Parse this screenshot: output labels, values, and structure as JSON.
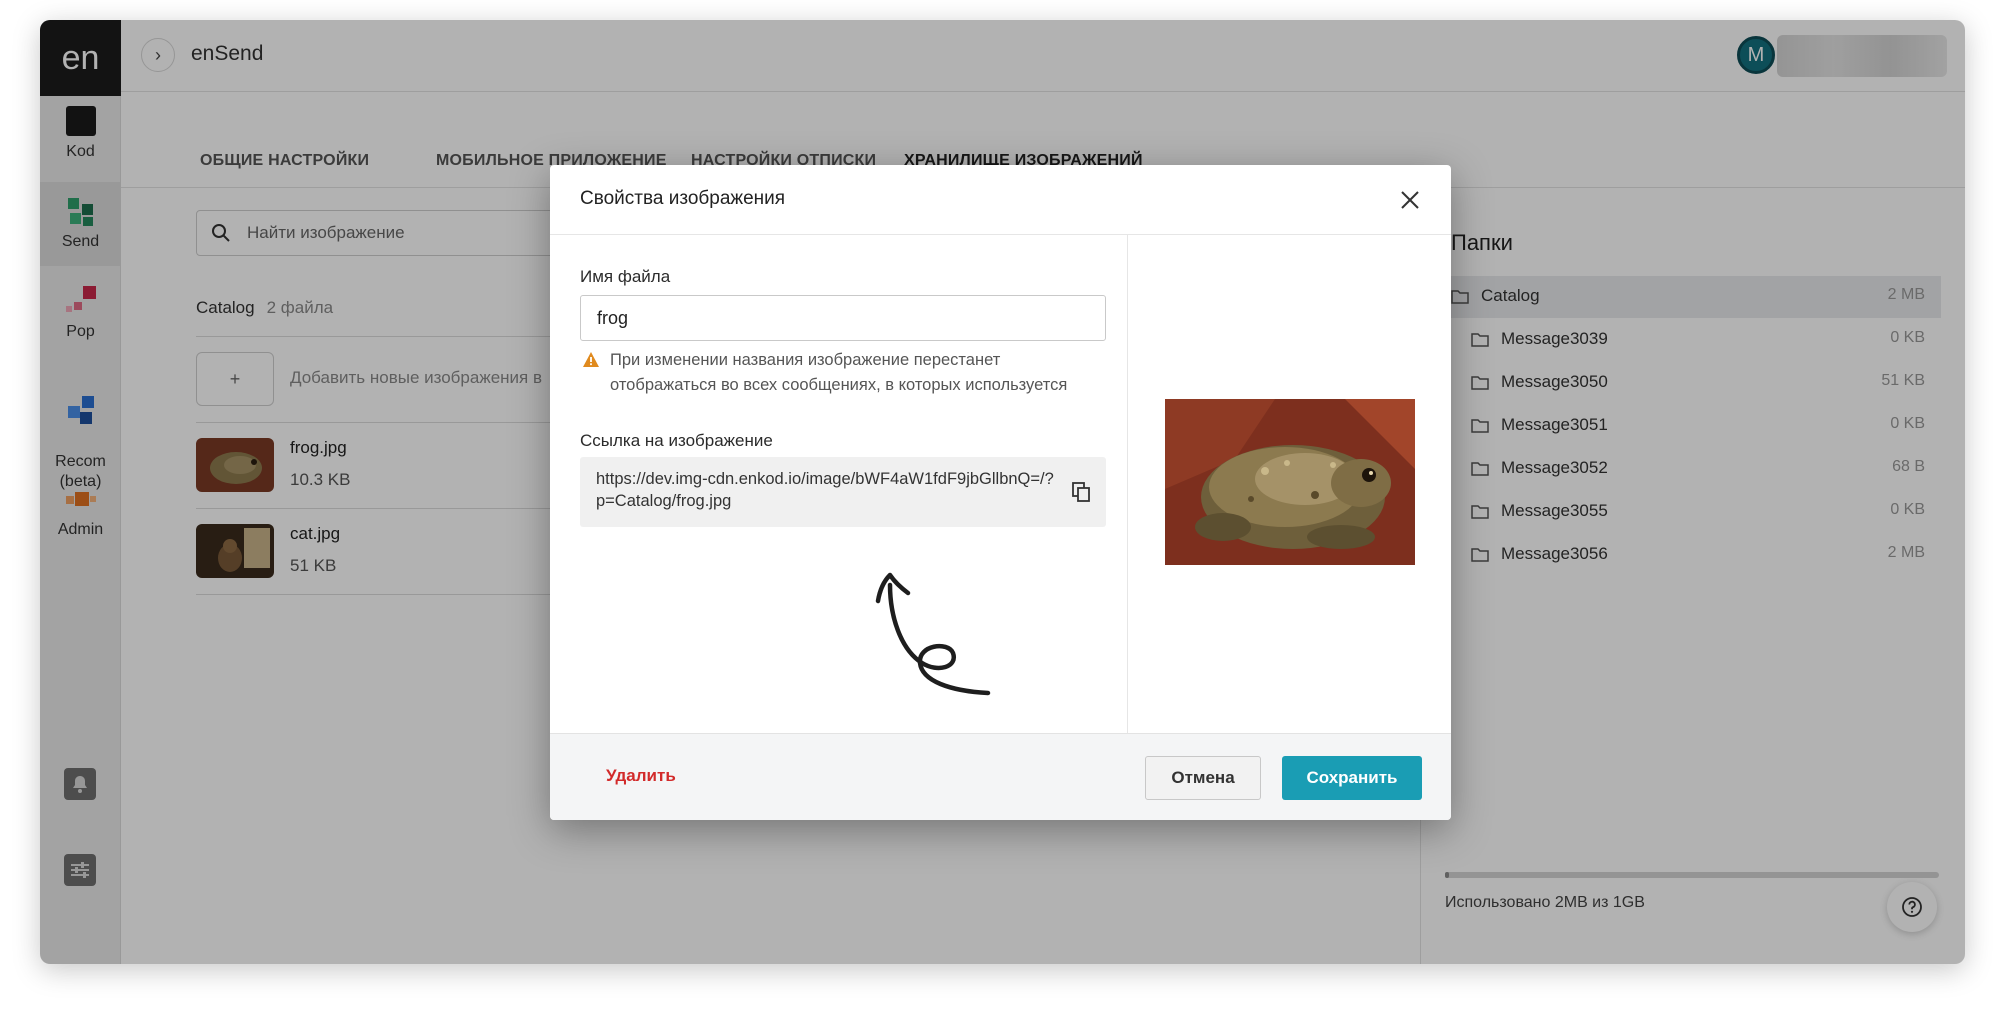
{
  "app": {
    "logo": "en",
    "title": "enSend",
    "avatar_initial": "M"
  },
  "rail": {
    "items": [
      {
        "label": "Kod",
        "icon": "kod-icon"
      },
      {
        "label": "Send",
        "icon": "send-icon"
      },
      {
        "label": "Pop",
        "icon": "pop-icon"
      },
      {
        "label": "Recom\n(beta)",
        "icon": "recom-icon"
      },
      {
        "label": "Admin",
        "icon": "admin-icon"
      }
    ]
  },
  "tabs": [
    {
      "label": "ОБЩИЕ НАСТРОЙКИ"
    },
    {
      "label": "МОБИЛЬНОЕ ПРИЛОЖЕНИЕ"
    },
    {
      "label": "НАСТРОЙКИ ОТПИСКИ"
    },
    {
      "label": "ХРАНИЛИЩЕ ИЗОБРАЖЕНИЙ",
      "active": true
    }
  ],
  "search": {
    "placeholder": "Найти изображение"
  },
  "breadcrumb": {
    "folder": "Catalog",
    "count": "2 файла"
  },
  "add_images_label": "Добавить новые изображения в",
  "add_button_label": "+",
  "files": [
    {
      "name": "frog.jpg",
      "size": "10.3 KB"
    },
    {
      "name": "cat.jpg",
      "size": "51 KB"
    }
  ],
  "folders": {
    "title": "Папки",
    "items": [
      {
        "name": "Catalog",
        "size": "2 MB",
        "selected": true
      },
      {
        "name": "Message3039",
        "size": "0 KB"
      },
      {
        "name": "Message3050",
        "size": "51 KB"
      },
      {
        "name": "Message3051",
        "size": "0 KB"
      },
      {
        "name": "Message3052",
        "size": "68 B"
      },
      {
        "name": "Message3055",
        "size": "0 KB"
      },
      {
        "name": "Message3056",
        "size": "2 MB"
      }
    ],
    "usage_text": "Использовано 2MB из 1GB",
    "usage_fraction": 0.002
  },
  "modal": {
    "title": "Свойства изображения",
    "filename_label": "Имя файла",
    "filename_value": "frog",
    "warning": "При изменении названия изображение перестанет отображаться во всех сообщениях, в которых используется",
    "link_label": "Ссылка на изображение",
    "link_value": "https://dev.img-cdn.enkod.io/image/bWF4aW1fdF9jbGllbnQ=/?p=Catalog/frog.jpg",
    "delete_label": "Удалить",
    "cancel_label": "Отмена",
    "save_label": "Сохранить"
  },
  "colors": {
    "accent": "#1a9db4",
    "danger": "#d22a2a",
    "warning": "#e08a1e"
  }
}
